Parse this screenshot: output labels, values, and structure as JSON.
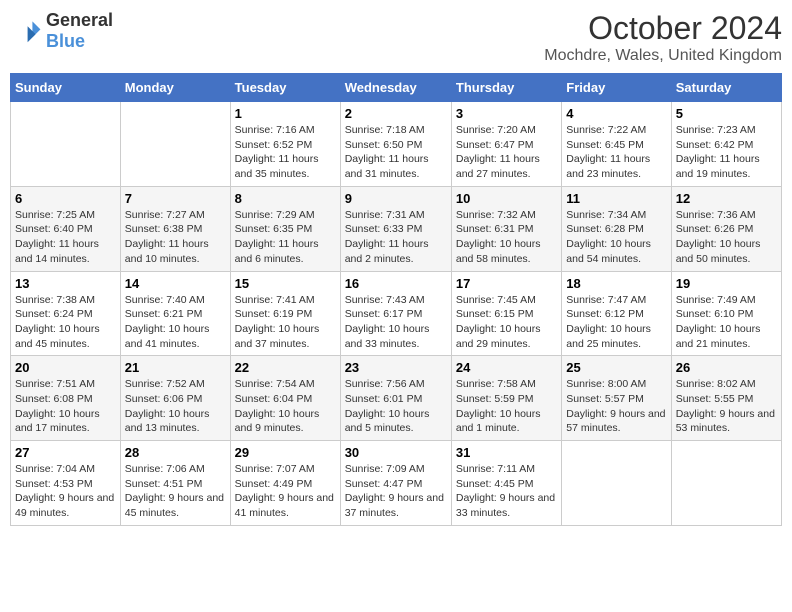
{
  "header": {
    "logo_general": "General",
    "logo_blue": "Blue",
    "title": "October 2024",
    "location": "Mochdre, Wales, United Kingdom"
  },
  "days_of_week": [
    "Sunday",
    "Monday",
    "Tuesday",
    "Wednesday",
    "Thursday",
    "Friday",
    "Saturday"
  ],
  "weeks": [
    [
      {
        "day": "",
        "sunrise": "",
        "sunset": "",
        "daylight": ""
      },
      {
        "day": "",
        "sunrise": "",
        "sunset": "",
        "daylight": ""
      },
      {
        "day": "1",
        "sunrise": "Sunrise: 7:16 AM",
        "sunset": "Sunset: 6:52 PM",
        "daylight": "Daylight: 11 hours and 35 minutes."
      },
      {
        "day": "2",
        "sunrise": "Sunrise: 7:18 AM",
        "sunset": "Sunset: 6:50 PM",
        "daylight": "Daylight: 11 hours and 31 minutes."
      },
      {
        "day": "3",
        "sunrise": "Sunrise: 7:20 AM",
        "sunset": "Sunset: 6:47 PM",
        "daylight": "Daylight: 11 hours and 27 minutes."
      },
      {
        "day": "4",
        "sunrise": "Sunrise: 7:22 AM",
        "sunset": "Sunset: 6:45 PM",
        "daylight": "Daylight: 11 hours and 23 minutes."
      },
      {
        "day": "5",
        "sunrise": "Sunrise: 7:23 AM",
        "sunset": "Sunset: 6:42 PM",
        "daylight": "Daylight: 11 hours and 19 minutes."
      }
    ],
    [
      {
        "day": "6",
        "sunrise": "Sunrise: 7:25 AM",
        "sunset": "Sunset: 6:40 PM",
        "daylight": "Daylight: 11 hours and 14 minutes."
      },
      {
        "day": "7",
        "sunrise": "Sunrise: 7:27 AM",
        "sunset": "Sunset: 6:38 PM",
        "daylight": "Daylight: 11 hours and 10 minutes."
      },
      {
        "day": "8",
        "sunrise": "Sunrise: 7:29 AM",
        "sunset": "Sunset: 6:35 PM",
        "daylight": "Daylight: 11 hours and 6 minutes."
      },
      {
        "day": "9",
        "sunrise": "Sunrise: 7:31 AM",
        "sunset": "Sunset: 6:33 PM",
        "daylight": "Daylight: 11 hours and 2 minutes."
      },
      {
        "day": "10",
        "sunrise": "Sunrise: 7:32 AM",
        "sunset": "Sunset: 6:31 PM",
        "daylight": "Daylight: 10 hours and 58 minutes."
      },
      {
        "day": "11",
        "sunrise": "Sunrise: 7:34 AM",
        "sunset": "Sunset: 6:28 PM",
        "daylight": "Daylight: 10 hours and 54 minutes."
      },
      {
        "day": "12",
        "sunrise": "Sunrise: 7:36 AM",
        "sunset": "Sunset: 6:26 PM",
        "daylight": "Daylight: 10 hours and 50 minutes."
      }
    ],
    [
      {
        "day": "13",
        "sunrise": "Sunrise: 7:38 AM",
        "sunset": "Sunset: 6:24 PM",
        "daylight": "Daylight: 10 hours and 45 minutes."
      },
      {
        "day": "14",
        "sunrise": "Sunrise: 7:40 AM",
        "sunset": "Sunset: 6:21 PM",
        "daylight": "Daylight: 10 hours and 41 minutes."
      },
      {
        "day": "15",
        "sunrise": "Sunrise: 7:41 AM",
        "sunset": "Sunset: 6:19 PM",
        "daylight": "Daylight: 10 hours and 37 minutes."
      },
      {
        "day": "16",
        "sunrise": "Sunrise: 7:43 AM",
        "sunset": "Sunset: 6:17 PM",
        "daylight": "Daylight: 10 hours and 33 minutes."
      },
      {
        "day": "17",
        "sunrise": "Sunrise: 7:45 AM",
        "sunset": "Sunset: 6:15 PM",
        "daylight": "Daylight: 10 hours and 29 minutes."
      },
      {
        "day": "18",
        "sunrise": "Sunrise: 7:47 AM",
        "sunset": "Sunset: 6:12 PM",
        "daylight": "Daylight: 10 hours and 25 minutes."
      },
      {
        "day": "19",
        "sunrise": "Sunrise: 7:49 AM",
        "sunset": "Sunset: 6:10 PM",
        "daylight": "Daylight: 10 hours and 21 minutes."
      }
    ],
    [
      {
        "day": "20",
        "sunrise": "Sunrise: 7:51 AM",
        "sunset": "Sunset: 6:08 PM",
        "daylight": "Daylight: 10 hours and 17 minutes."
      },
      {
        "day": "21",
        "sunrise": "Sunrise: 7:52 AM",
        "sunset": "Sunset: 6:06 PM",
        "daylight": "Daylight: 10 hours and 13 minutes."
      },
      {
        "day": "22",
        "sunrise": "Sunrise: 7:54 AM",
        "sunset": "Sunset: 6:04 PM",
        "daylight": "Daylight: 10 hours and 9 minutes."
      },
      {
        "day": "23",
        "sunrise": "Sunrise: 7:56 AM",
        "sunset": "Sunset: 6:01 PM",
        "daylight": "Daylight: 10 hours and 5 minutes."
      },
      {
        "day": "24",
        "sunrise": "Sunrise: 7:58 AM",
        "sunset": "Sunset: 5:59 PM",
        "daylight": "Daylight: 10 hours and 1 minute."
      },
      {
        "day": "25",
        "sunrise": "Sunrise: 8:00 AM",
        "sunset": "Sunset: 5:57 PM",
        "daylight": "Daylight: 9 hours and 57 minutes."
      },
      {
        "day": "26",
        "sunrise": "Sunrise: 8:02 AM",
        "sunset": "Sunset: 5:55 PM",
        "daylight": "Daylight: 9 hours and 53 minutes."
      }
    ],
    [
      {
        "day": "27",
        "sunrise": "Sunrise: 7:04 AM",
        "sunset": "Sunset: 4:53 PM",
        "daylight": "Daylight: 9 hours and 49 minutes."
      },
      {
        "day": "28",
        "sunrise": "Sunrise: 7:06 AM",
        "sunset": "Sunset: 4:51 PM",
        "daylight": "Daylight: 9 hours and 45 minutes."
      },
      {
        "day": "29",
        "sunrise": "Sunrise: 7:07 AM",
        "sunset": "Sunset: 4:49 PM",
        "daylight": "Daylight: 9 hours and 41 minutes."
      },
      {
        "day": "30",
        "sunrise": "Sunrise: 7:09 AM",
        "sunset": "Sunset: 4:47 PM",
        "daylight": "Daylight: 9 hours and 37 minutes."
      },
      {
        "day": "31",
        "sunrise": "Sunrise: 7:11 AM",
        "sunset": "Sunset: 4:45 PM",
        "daylight": "Daylight: 9 hours and 33 minutes."
      },
      {
        "day": "",
        "sunrise": "",
        "sunset": "",
        "daylight": ""
      },
      {
        "day": "",
        "sunrise": "",
        "sunset": "",
        "daylight": ""
      }
    ]
  ]
}
